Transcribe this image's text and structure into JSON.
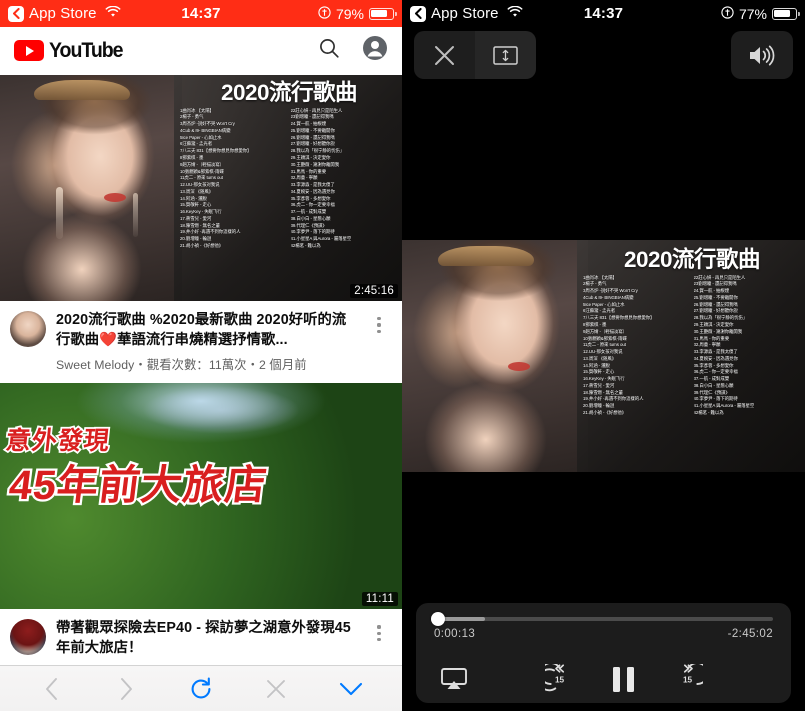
{
  "left": {
    "status_bar": {
      "back_label": "App Store",
      "back_icon": "chevron-left-icon",
      "wifi_icon": "wifi-icon",
      "time": "14:37",
      "orientation_lock_icon": "rotation-lock-icon",
      "battery_percent": "79%",
      "battery_level": 79,
      "accent_color": "#FF2D15"
    },
    "app_header": {
      "logo_text": "YouTube",
      "logo_icon": "youtube-play-icon",
      "brand_color": "#FF0000",
      "search_icon": "search-icon",
      "account_icon": "account-circle-icon"
    },
    "videos": [
      {
        "thumbnail_title": "2020流行歌曲",
        "duration": "2:45:16",
        "title": "2020流行歌曲 %2020最新歌曲 2020好听的流行歌曲❤️華語流行串燒精選抒情歌...",
        "channel": "Sweet Melody",
        "meta": "Sweet Melody・觀看次數：11萬次・2 個月前",
        "menu_icon": "kebab-menu-icon",
        "avatar_icon": "channel-avatar",
        "tracklist_left": [
          "1曲肖冰 【太陽】",
          "2楊子 - 勇气",
          "3周杰炉 -說好不哭 Won't Cry",
          "4Cub & I9- BINGBIAN病變",
          "5Ice Paper - 心如止水",
          "6汪蘇瀧 - 孟光者",
          "7八三夭 831【想要你想見你想愛你】",
          "8鄧紫棋 - 墨",
          "9趙方婧 -（輕描淡寫）",
          "10張靚穎&鄧紫棋-雨蝶",
          "11虎二 - 原來 turns out",
          "12.UU-那女孩对我说",
          "13.周深 《随風》",
          "14.阿涵 - 灑脫",
          "15.賀敬軒 - 走心",
          "16.KeyKey - 失眠飞行",
          "17.蔣雪兒 - 愛河",
          "18.陳雪燃 - 無名之輩",
          "19.井小好 -再遇不到你這樣的人",
          "20.劉增瞳 - 輪迴",
          "21.胡小禎 -《好想他》"
        ],
        "tracklist_right": [
          "22莊心妍 - 再見只是陌生人",
          "23劉增瞳 - 還記得我嗎",
          "24.賀一航 - 抽根煙",
          "25.劉增瞳 - 不要離開你",
          "26.劉增瞳 - 還記得我嗎",
          "27.劉增瞳 - 好想聽你說",
          "28.我以為「很宁静的忧伤」",
          "29.王穎淇 - 決定愛你",
          "30.王艷薇 - 謝謝你離開我",
          "31.馬馬 - 你的重要",
          "32.周童 - 寧願",
          "33.李源淼 - 是我太傻了",
          "34.夏婉安 - 因為遇見你",
          "35.李彥蓉 - 多想愛你",
          "36.虎二 - 你一定要幸福",
          "37.一航 - 成對成雙",
          "38.白小白 - 星態心願",
          "39.代理仁《預謀》",
          "40.李夢尹 - 落下的期待",
          "41.小星星A 與Aurora - 屬落星空",
          "42楊茗 - 難以為"
        ]
      },
      {
        "thumbnail_overlay_line1": "意外發現",
        "thumbnail_overlay_line2": "45年前大旅店",
        "duration": "11:11",
        "title": "帶著觀眾探險去EP40 - 探訪夢之湖意外發現45年前大旅店！",
        "menu_icon": "kebab-menu-icon",
        "avatar_icon": "channel-avatar"
      }
    ],
    "safari_toolbar": {
      "items": [
        {
          "name": "back-button",
          "icon": "chevron-left-icon",
          "enabled": false
        },
        {
          "name": "forward-button",
          "icon": "chevron-right-icon",
          "enabled": false
        },
        {
          "name": "reload-button",
          "icon": "reload-icon",
          "enabled": true
        },
        {
          "name": "stop-button",
          "icon": "close-x-icon",
          "enabled": false
        },
        {
          "name": "dismiss-button",
          "icon": "chevron-down-icon",
          "enabled": true
        }
      ],
      "accent_color": "#007AFF"
    }
  },
  "right": {
    "status_bar": {
      "back_label": "App Store",
      "back_icon": "chevron-left-icon",
      "wifi_icon": "wifi-icon",
      "time": "14:37",
      "orientation_lock_icon": "rotation-lock-icon",
      "battery_percent": "77%",
      "battery_level": 77
    },
    "top_controls": {
      "close_icon": "close-x-icon",
      "aspect_fit_icon": "aspect-ratio-icon",
      "volume_icon": "volume-up-icon"
    },
    "video": {
      "thumbnail_title": "2020流行歌曲",
      "tracklist_left": [
        "1曲肖冰 【太陽】",
        "2楊子 - 勇气",
        "3周杰炉 -說好不哭 Won't Cry",
        "4Cub & I9- BINGBIAN病變",
        "5Ice Paper - 心如止水",
        "6汪蘇瀧 - 孟光者",
        "7八三夭 831【想要你想見你想愛你】",
        "8鄧紫棋 - 墨",
        "9趙方婧 -（輕描淡寫）",
        "10張靚穎&鄧紫棋-雨蝶",
        "11虎二 - 原來 turns out",
        "12.UU-那女孩对我说",
        "13.周深 《随風》",
        "14.阿涵 - 灑脫",
        "15.賀敬軒 - 走心",
        "16.KeyKey - 失眠飞行",
        "17.蔣雪兒 - 愛河",
        "18.陳雪燃 - 無名之輩",
        "19.井小好 -再遇不到你這樣的人",
        "20.劉增瞳 - 輪迴",
        "21.胡小禎 -《好想他》"
      ],
      "tracklist_right": [
        "22莊心妍 - 再見只是陌生人",
        "23劉增瞳 - 還記得我嗎",
        "24.賀一航 - 抽根煙",
        "25.劉增瞳 - 不要離開你",
        "26.劉增瞳 - 還記得我嗎",
        "27.劉增瞳 - 好想聽你說",
        "28.我以為「很宁静的忧伤」",
        "29.王穎淇 - 決定愛你",
        "30.王艷薇 - 謝謝你離開我",
        "31.馬馬 - 你的重要",
        "32.周童 - 寧願",
        "33.李源淼 - 是我太傻了",
        "34.夏婉安 - 因為遇見你",
        "35.李彥蓉 - 多想愛你",
        "36.虎二 - 你一定要幸福",
        "37.一航 - 成對成雙",
        "38.白小白 - 星態心願",
        "39.代理仁《預謀》",
        "40.李夢尹 - 落下的期待",
        "41.小星星A 與Aurora - 屬落星空",
        "42楊茗 - 難以為"
      ]
    },
    "player": {
      "elapsed": "0:00:13",
      "remaining": "-2:45:02",
      "progress_percent": 1.3,
      "buffered_percent": 15,
      "airplay_icon": "airplay-icon",
      "rewind_icon": "rewind-15-icon",
      "rewind_label": "15",
      "playpause_icon": "pause-icon",
      "forward_icon": "forward-15-icon",
      "forward_label": "15"
    }
  }
}
